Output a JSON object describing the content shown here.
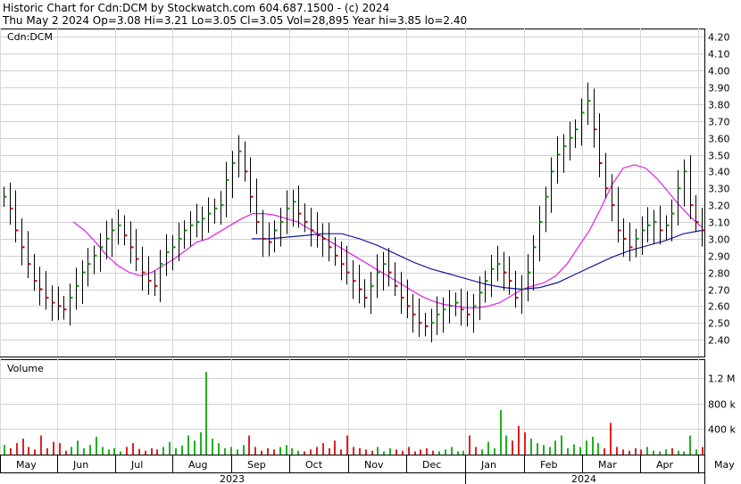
{
  "header": {
    "line1": "Historic Chart for Cdn:DCM by Stockwatch.com 604.687.1500 - (c) 2024",
    "line2": "Thu May  2 2024   Op=3.08  Hi=3.21  Lo=3.05  Cl=3.05  Vol=28,895  Year hi=3.85  lo=2.40"
  },
  "chart_data": [
    {
      "type": "ohlc",
      "title": "Cdn:DCM",
      "ylim": [
        2.3,
        4.25
      ],
      "y_ticks": [
        "4.20",
        "4.10",
        "4.00",
        "3.90",
        "3.80",
        "3.70",
        "3.60",
        "3.50",
        "3.40",
        "3.30",
        "3.20",
        "3.10",
        "3.00",
        "2.90",
        "2.80",
        "2.70",
        "2.60",
        "2.50",
        "2.40"
      ],
      "months": [
        "May",
        "Jun",
        "Jul",
        "Aug",
        "Sep",
        "Oct",
        "Nov",
        "Dec",
        "Jan",
        "Feb",
        "Mar",
        "Apr",
        "May"
      ],
      "years": [
        "2023",
        "2024"
      ],
      "series": [
        {
          "name": "Price",
          "values": [
            3.25,
            3.18,
            3.05,
            2.95,
            2.85,
            2.75,
            2.7,
            2.65,
            2.62,
            2.6,
            2.58,
            2.65,
            2.72,
            2.8,
            2.85,
            2.9,
            2.95,
            3.0,
            3.05,
            3.08,
            3.02,
            2.95,
            2.88,
            2.8,
            2.75,
            2.72,
            2.85,
            2.92,
            2.95,
            3.0,
            3.05,
            3.08,
            3.1,
            3.12,
            3.15,
            3.18,
            3.2,
            3.35,
            3.45,
            3.52,
            3.4,
            3.25,
            3.1,
            3.0,
            2.98,
            3.05,
            3.1,
            3.18,
            3.22,
            3.15,
            3.1,
            3.05,
            3.02,
            3.0,
            2.95,
            2.9,
            2.85,
            2.8,
            2.75,
            2.7,
            2.65,
            2.72,
            2.8,
            2.85,
            2.8,
            2.72,
            2.65,
            2.6,
            2.55,
            2.5,
            2.48,
            2.5,
            2.55,
            2.58,
            2.6,
            2.62,
            2.58,
            2.55,
            2.6,
            2.68,
            2.75,
            2.82,
            2.85,
            2.8,
            2.75,
            2.65,
            2.7,
            2.8,
            2.95,
            3.1,
            3.25,
            3.4,
            3.5,
            3.55,
            3.6,
            3.65,
            3.75,
            3.82,
            3.65,
            3.45,
            3.3,
            3.2,
            3.05,
            3.0,
            2.95,
            3.0,
            3.05,
            3.08,
            3.1,
            3.05,
            3.08,
            3.15,
            3.3,
            3.4,
            3.2,
            3.1,
            3.05
          ]
        },
        {
          "name": "MA short",
          "values": [
            3.1,
            3.05,
            2.98,
            2.9,
            2.84,
            2.8,
            2.78,
            2.8,
            2.84,
            2.88,
            2.93,
            2.98,
            3.0,
            3.04,
            3.08,
            3.12,
            3.15,
            3.15,
            3.14,
            3.12,
            3.1,
            3.06,
            3.02,
            2.98,
            2.94,
            2.9,
            2.86,
            2.82,
            2.78,
            2.74,
            2.7,
            2.66,
            2.63,
            2.61,
            2.6,
            2.59,
            2.59,
            2.6,
            2.62,
            2.66,
            2.7,
            2.72,
            2.74,
            2.78,
            2.85,
            2.95,
            3.05,
            3.18,
            3.32,
            3.42,
            3.44,
            3.42,
            3.36,
            3.28,
            3.2,
            3.13,
            3.07
          ]
        },
        {
          "name": "MA long",
          "values": [
            3.0,
            3.0,
            3.01,
            3.02,
            3.03,
            3.03,
            3.0,
            2.96,
            2.91,
            2.86,
            2.82,
            2.79,
            2.76,
            2.73,
            2.71,
            2.7,
            2.71,
            2.74,
            2.79,
            2.84,
            2.89,
            2.93,
            2.96,
            2.99,
            3.03,
            3.05
          ]
        }
      ]
    },
    {
      "type": "bar",
      "title": "Volume",
      "ylim": [
        0,
        1500000
      ],
      "y_ticks": [
        "1.2 M",
        "800 k",
        "400 k"
      ],
      "series": [
        {
          "name": "Volume",
          "values": [
            0.15,
            0.1,
            0.18,
            0.25,
            0.12,
            0.08,
            0.3,
            0.1,
            0.2,
            0.18,
            0.06,
            0.12,
            0.22,
            0.1,
            0.15,
            0.28,
            0.12,
            0.08,
            0.1,
            0.05,
            0.12,
            0.18,
            0.09,
            0.06,
            0.1,
            0.08,
            0.12,
            0.2,
            0.1,
            0.14,
            0.3,
            0.22,
            0.35,
            1.3,
            0.25,
            0.18,
            0.1,
            0.12,
            0.08,
            0.15,
            0.3,
            0.12,
            0.06,
            0.1,
            0.08,
            0.12,
            0.15,
            0.1,
            0.06,
            0.05,
            0.08,
            0.12,
            0.18,
            0.1,
            0.22,
            0.08,
            0.3,
            0.12,
            0.1,
            0.08,
            0.06,
            0.12,
            0.05,
            0.1,
            0.08,
            0.06,
            0.12,
            0.05,
            0.08,
            0.1,
            0.06,
            0.05,
            0.08,
            0.12,
            0.05,
            0.06,
            0.3,
            0.12,
            0.08,
            0.2,
            0.1,
            0.7,
            0.3,
            0.22,
            0.45,
            0.35,
            0.25,
            0.18,
            0.15,
            0.12,
            0.22,
            0.3,
            0.1,
            0.16,
            0.12,
            0.22,
            0.28,
            0.18,
            0.1,
            0.5,
            0.12,
            0.08,
            0.06,
            0.1,
            0.08,
            0.12,
            0.06,
            0.05,
            0.08,
            0.1,
            0.06,
            0.05,
            0.3,
            0.08,
            0.12
          ]
        }
      ]
    }
  ]
}
